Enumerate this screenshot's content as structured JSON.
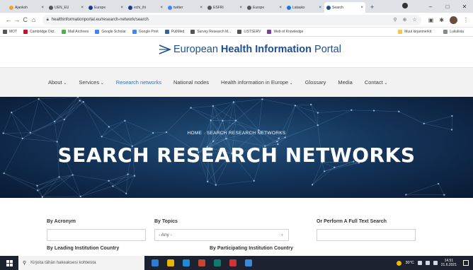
{
  "browser": {
    "tabs": [
      {
        "label": "Ajankoh",
        "color": "#e8a33d"
      },
      {
        "label": "UEN_EU",
        "color": "#555555"
      },
      {
        "label": "Europe",
        "color": "#1a3a8a"
      },
      {
        "label": "echi_ihi",
        "color": "#1a3a8a"
      },
      {
        "label": "twitter",
        "color": "#4285f4"
      },
      {
        "label": "ESFRI",
        "color": "#555555"
      },
      {
        "label": "Europe",
        "color": "#555555"
      },
      {
        "label": "Latauks",
        "color": "#1a73e8"
      },
      {
        "label": "Search",
        "color": "#1f4f8f",
        "active": true
      }
    ],
    "new_tab": "+",
    "close_glyph": "×",
    "window_controls": {
      "minimize": "–",
      "maximize": "□",
      "close": "✕"
    },
    "nav": {
      "back": "←",
      "forward": "→",
      "reload": "C",
      "home": "⌂"
    },
    "url": "healthinformationportal.eu/research-network/search",
    "bookmarks": [
      {
        "label": "MOT",
        "color": "#555555"
      },
      {
        "label": "Cambridge Dict.",
        "color": "#c8102e"
      },
      {
        "label": "Mail Archives",
        "color": "#4caf50"
      },
      {
        "label": "Google Scholar",
        "color": "#4285f4"
      },
      {
        "label": "Google Print",
        "color": "#4285f4"
      },
      {
        "label": "PubMed",
        "color": "#336699"
      },
      {
        "label": "Survey Research M...",
        "color": "#555555"
      },
      {
        "label": "LISTSERV",
        "color": "#555555"
      },
      {
        "label": "Web of Knowledge",
        "color": "#7b3fa0"
      }
    ],
    "bookmarks_right": [
      {
        "label": "Muut kirjanmerkit"
      },
      {
        "label": "Lukulista"
      }
    ]
  },
  "site": {
    "logo_text_plain": "European ",
    "logo_text_bold": "Health Information",
    "logo_text_end": " Portal",
    "logo_color": "#1f4f8f",
    "nav": [
      {
        "label": "About",
        "dropdown": true
      },
      {
        "label": "Services",
        "dropdown": true
      },
      {
        "label": "Research networks",
        "active": true
      },
      {
        "label": "National nodes"
      },
      {
        "label": "Health information in Europe",
        "dropdown": true
      },
      {
        "label": "Glossary"
      },
      {
        "label": "Media"
      },
      {
        "label": "Contact",
        "dropdown": true
      }
    ],
    "breadcrumb_home": "HOME",
    "breadcrumb_sep": "·",
    "breadcrumb_current": "SEARCH RESEARCH NETWORKS",
    "hero_title": "SEARCH RESEARCH NETWORKS"
  },
  "search": {
    "acronym_label": "By Acronym",
    "topics_label": "By Topics",
    "topics_value": "- Any -",
    "fulltext_label": "Or Perform A Full Text Search",
    "leading_label": "By Leading Institution Country",
    "participating_label": "By Participating Institution Country"
  },
  "taskbar": {
    "search_placeholder": "Kirjoita tähän hakeaksesi kohteista",
    "temperature": "30°C",
    "time": "14.51",
    "date": "21.6.2021",
    "apps": [
      "#2d7dd2",
      "#e8b400",
      "#1f8ad6",
      "#c7462e",
      "#0f7b6c",
      "#d13438",
      "#3b8ad9"
    ]
  }
}
